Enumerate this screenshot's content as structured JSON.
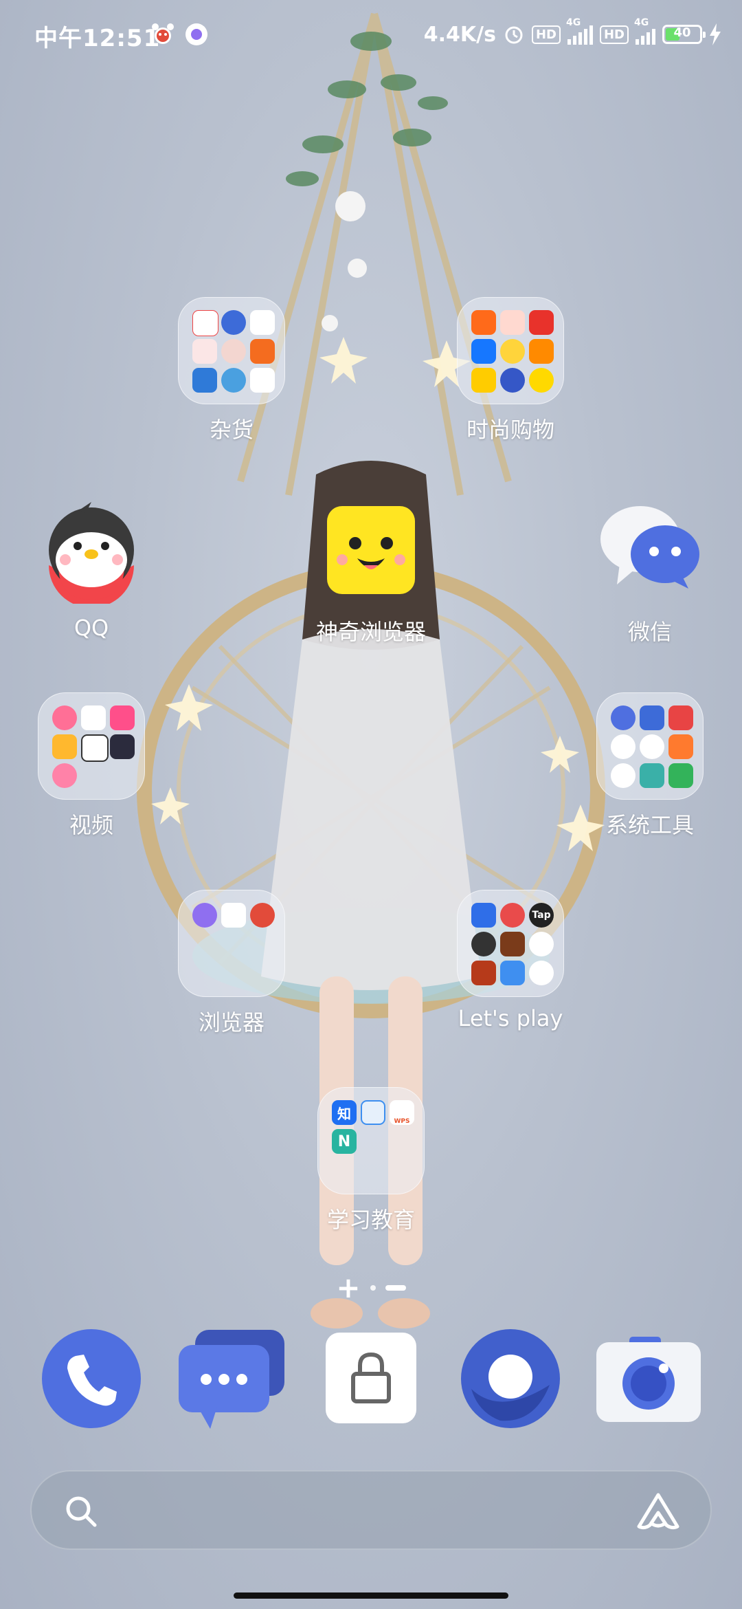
{
  "status_bar": {
    "time": "中午12:51",
    "net_speed": "4.4K/s",
    "hd1": "HD",
    "sim1": "4G",
    "hd2": "HD",
    "sim2": "4G",
    "battery": "40"
  },
  "apps": {
    "folder_zahuo": "杂货",
    "folder_shopping": "时尚购物",
    "qq": "QQ",
    "browser_magic": "神奇浏览器",
    "wechat": "微信",
    "folder_video": "视频",
    "folder_system_tools": "系统工具",
    "folder_browser": "浏览器",
    "folder_lets_play": "Let's play",
    "folder_study": "学习教育"
  },
  "folder_icons": {
    "study": {
      "a": "知",
      "c": "WPS",
      "d": "N"
    },
    "lets_play": {
      "tap": "Tap"
    }
  },
  "page_indicator": {
    "plus": "+"
  },
  "colors": {
    "accent_blue": "#4f6fe0",
    "wallpaper": "#b9c1cf"
  },
  "icons": [
    "search-icon",
    "assistant-icon",
    "phone-icon",
    "messages-icon",
    "lock-icon",
    "browser-icon",
    "camera-icon"
  ]
}
